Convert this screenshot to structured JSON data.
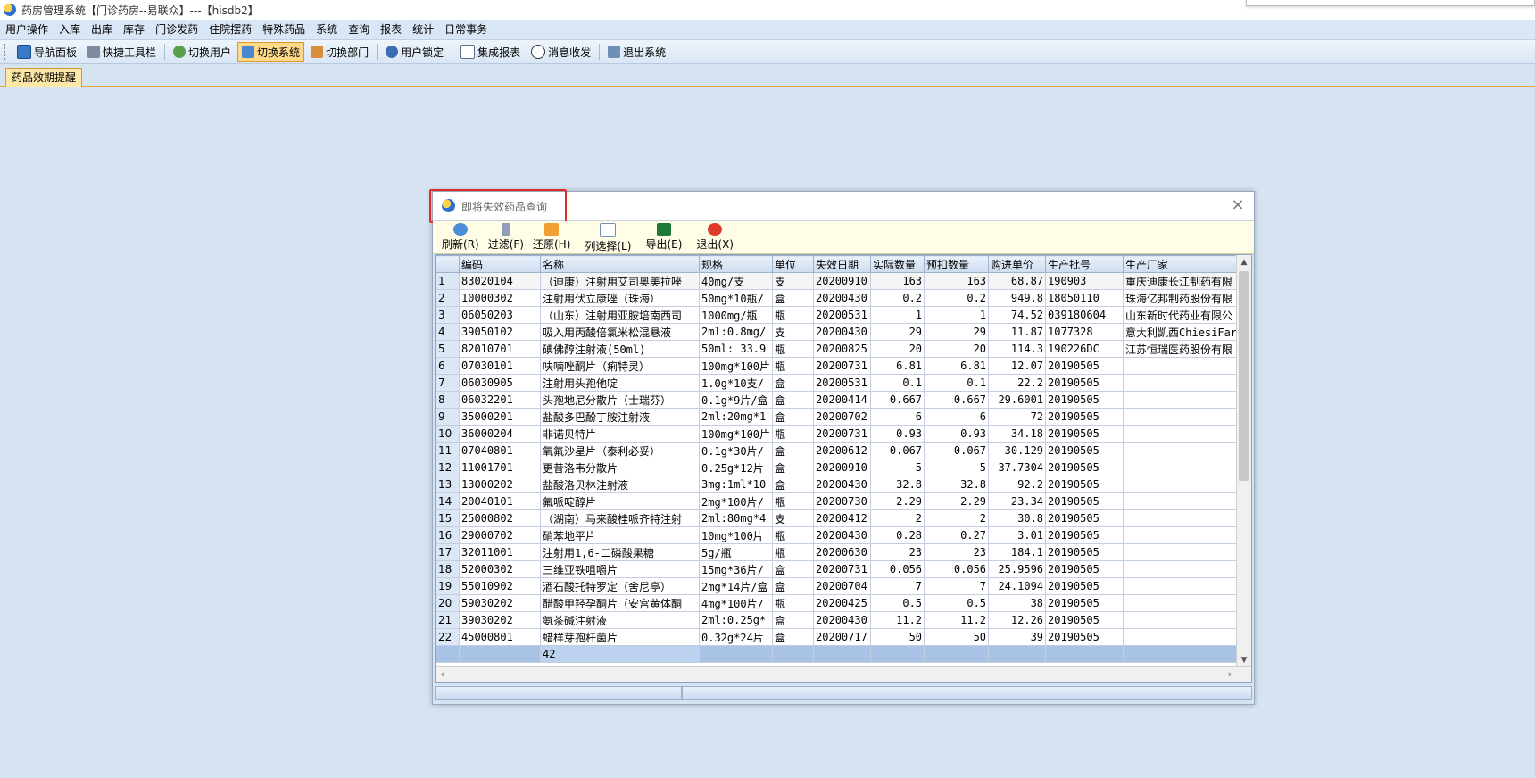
{
  "app": {
    "title": "药房管理系统【门诊药房--易联众】---【hisdb2】"
  },
  "menu": [
    "用户操作",
    "入库",
    "出库",
    "库存",
    "门诊发药",
    "住院摆药",
    "特殊药品",
    "系统",
    "查询",
    "报表",
    "统计",
    "日常事务"
  ],
  "toolbar": {
    "nav_panel": "导航面板",
    "quick_toolbar": "快捷工具栏",
    "switch_user": "切换用户",
    "switch_system": "切换系统",
    "switch_dept": "切换部门",
    "user_lock": "用户锁定",
    "integrated_report": "集成报表",
    "messages": "消息收发",
    "exit_system": "退出系统"
  },
  "doc_tab": "药品效期提醒",
  "dialog": {
    "title": "即将失效药品查询",
    "close": "×",
    "buttons": {
      "refresh": "刷新(R)",
      "filter": "过滤(F)",
      "restore": "还原(H)",
      "column_select": "列选择(L)",
      "export": "导出(E)",
      "exit": "退出(X)"
    },
    "columns": [
      "编码",
      "名称",
      "规格",
      "单位",
      "失效日期",
      "实际数量",
      "预扣数量",
      "购进单价",
      "生产批号",
      "生产厂家"
    ],
    "rows": [
      [
        "83020104",
        "（迪康）注射用艾司奥美拉唑",
        "40mg/支",
        "支",
        "20200910",
        "163",
        "163",
        "68.87",
        "190903",
        "重庆迪康长江制药有限"
      ],
      [
        "10000302",
        "注射用伏立康唑（珠海）",
        "50mg*10瓶/",
        "盒",
        "20200430",
        "0.2",
        "0.2",
        "949.8",
        "18050110",
        "珠海亿邦制药股份有限"
      ],
      [
        "06050203",
        "（山东）注射用亚胺培南西司",
        "1000mg/瓶",
        "瓶",
        "20200531",
        "1",
        "1",
        "74.52",
        "039180604",
        "山东新时代药业有限公"
      ],
      [
        "39050102",
        "吸入用丙酸倍氯米松混悬液",
        "2ml:0.8mg/",
        "支",
        "20200430",
        "29",
        "29",
        "11.87",
        "1077328",
        "意大利凯西ChiesiFar"
      ],
      [
        "82010701",
        "碘佛醇注射液(50ml)",
        "50ml: 33.9",
        "瓶",
        "20200825",
        "20",
        "20",
        "114.3",
        "190226DC",
        "江苏恒瑞医药股份有限"
      ],
      [
        "07030101",
        "呋喃唑酮片（痢特灵）",
        "100mg*100片",
        "瓶",
        "20200731",
        "6.81",
        "6.81",
        "12.07",
        "20190505",
        ""
      ],
      [
        "06030905",
        "注射用头孢他啶",
        "1.0g*10支/",
        "盒",
        "20200531",
        "0.1",
        "0.1",
        "22.2",
        "20190505",
        ""
      ],
      [
        "06032201",
        "头孢地尼分散片（士瑞芬）",
        "0.1g*9片/盒",
        "盒",
        "20200414",
        "0.667",
        "0.667",
        "29.6001",
        "20190505",
        ""
      ],
      [
        "35000201",
        "盐酸多巴酚丁胺注射液",
        "2ml:20mg*1",
        "盒",
        "20200702",
        "6",
        "6",
        "72",
        "20190505",
        ""
      ],
      [
        "36000204",
        "非诺贝特片",
        "100mg*100片",
        "瓶",
        "20200731",
        "0.93",
        "0.93",
        "34.18",
        "20190505",
        ""
      ],
      [
        "07040801",
        "氧氟沙星片（泰利必妥）",
        "0.1g*30片/",
        "盒",
        "20200612",
        "0.067",
        "0.067",
        "30.129",
        "20190505",
        ""
      ],
      [
        "11001701",
        "更昔洛韦分散片",
        "0.25g*12片",
        "盒",
        "20200910",
        "5",
        "5",
        "37.7304",
        "20190505",
        ""
      ],
      [
        "13000202",
        "盐酸洛贝林注射液",
        "3mg:1ml*10",
        "盒",
        "20200430",
        "32.8",
        "32.8",
        "92.2",
        "20190505",
        ""
      ],
      [
        "20040101",
        "氟哌啶醇片",
        "2mg*100片/",
        "瓶",
        "20200730",
        "2.29",
        "2.29",
        "23.34",
        "20190505",
        ""
      ],
      [
        "25000802",
        "（湖南）马来酸桂哌齐特注射",
        "2ml:80mg*4",
        "支",
        "20200412",
        "2",
        "2",
        "30.8",
        "20190505",
        ""
      ],
      [
        "29000702",
        "硝苯地平片",
        "10mg*100片",
        "瓶",
        "20200430",
        "0.28",
        "0.27",
        "3.01",
        "20190505",
        ""
      ],
      [
        "32011001",
        "注射用1,6-二磷酸果糖",
        "5g/瓶",
        "瓶",
        "20200630",
        "23",
        "23",
        "184.1",
        "20190505",
        ""
      ],
      [
        "52000302",
        "三维亚铁咀嚼片",
        "15mg*36片/",
        "盒",
        "20200731",
        "0.056",
        "0.056",
        "25.9596",
        "20190505",
        ""
      ],
      [
        "55010902",
        "酒石酸托特罗定（舍尼亭）",
        "2mg*14片/盒",
        "盒",
        "20200704",
        "7",
        "7",
        "24.1094",
        "20190505",
        ""
      ],
      [
        "59030202",
        "醋酸甲羟孕酮片（安宫黄体酮",
        "4mg*100片/",
        "瓶",
        "20200425",
        "0.5",
        "0.5",
        "38",
        "20190505",
        ""
      ],
      [
        "39030202",
        "氨茶碱注射液",
        "2ml:0.25g*",
        "盒",
        "20200430",
        "11.2",
        "11.2",
        "12.26",
        "20190505",
        ""
      ],
      [
        "45000801",
        "蜡样芽孢杆菌片",
        "0.32g*24片",
        "盒",
        "20200717",
        "50",
        "50",
        "39",
        "20190505",
        ""
      ]
    ],
    "footer_count": "42"
  },
  "colors": {
    "background": "#d6e4f2",
    "highlight_box": "#e02b2b",
    "active_tool": "#ffd98a",
    "dialog_toolbar": "#fffde6"
  }
}
